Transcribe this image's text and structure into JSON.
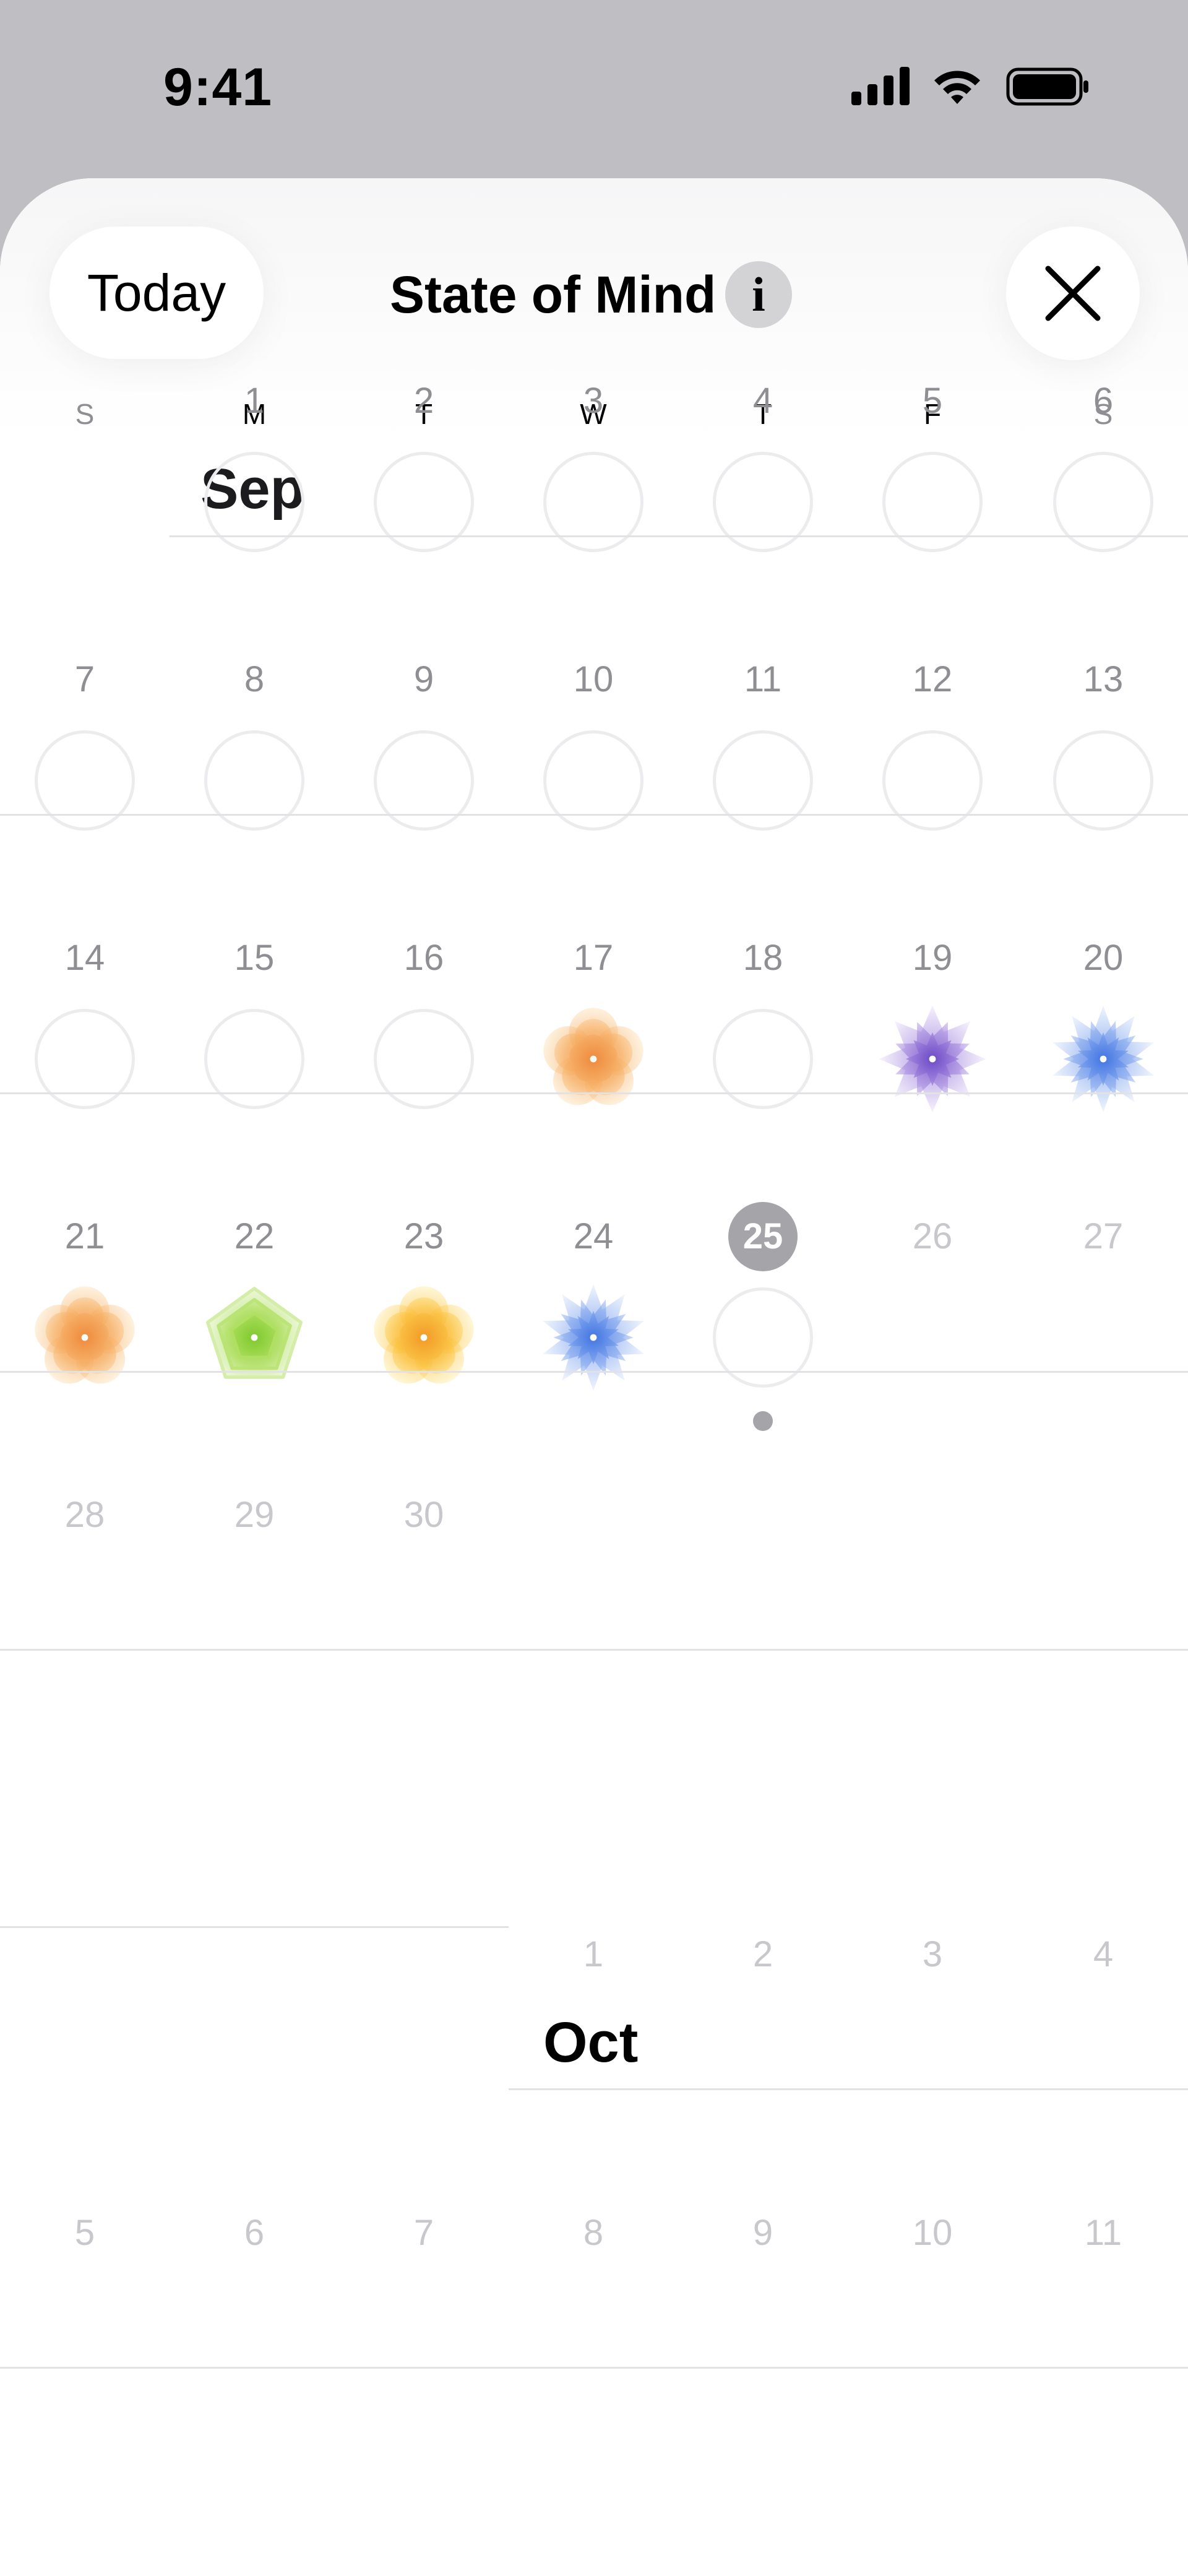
{
  "status_bar": {
    "time": "9:41",
    "icons": [
      "cellular-signal-icon",
      "wifi-icon",
      "battery-icon"
    ]
  },
  "nav": {
    "today_label": "Today",
    "title": "State of Mind",
    "info_icon": "info-icon",
    "close_icon": "close-icon"
  },
  "weekdays": [
    "S",
    "M",
    "T",
    "W",
    "T",
    "F",
    "S"
  ],
  "september": {
    "label": "Sep",
    "weeks": [
      [
        null,
        {
          "day": "1",
          "mark": "empty"
        },
        {
          "day": "2",
          "mark": "empty"
        },
        {
          "day": "3",
          "mark": "empty"
        },
        {
          "day": "4",
          "mark": "empty"
        },
        {
          "day": "5",
          "mark": "empty"
        },
        {
          "day": "6",
          "mark": "empty"
        }
      ],
      [
        {
          "day": "7",
          "mark": "empty"
        },
        {
          "day": "8",
          "mark": "empty"
        },
        {
          "day": "9",
          "mark": "empty"
        },
        {
          "day": "10",
          "mark": "empty"
        },
        {
          "day": "11",
          "mark": "empty"
        },
        {
          "day": "12",
          "mark": "empty"
        },
        {
          "day": "13",
          "mark": "empty"
        }
      ],
      [
        {
          "day": "14",
          "mark": "empty"
        },
        {
          "day": "15",
          "mark": "empty"
        },
        {
          "day": "16",
          "mark": "empty"
        },
        {
          "day": "17",
          "mark": "pleasant-orange"
        },
        {
          "day": "18",
          "mark": "empty"
        },
        {
          "day": "19",
          "mark": "unpleasant-purple"
        },
        {
          "day": "20",
          "mark": "unpleasant-blue"
        }
      ],
      [
        {
          "day": "21",
          "mark": "pleasant-orange"
        },
        {
          "day": "22",
          "mark": "neutral-green"
        },
        {
          "day": "23",
          "mark": "pleasant-yellow"
        },
        {
          "day": "24",
          "mark": "unpleasant-blue"
        },
        {
          "day": "25",
          "mark": "empty",
          "today": true,
          "dot": true
        },
        {
          "day": "26",
          "future": true
        },
        {
          "day": "27",
          "future": true
        }
      ],
      [
        {
          "day": "28",
          "future": true
        },
        {
          "day": "29",
          "future": true
        },
        {
          "day": "30",
          "future": true
        },
        null,
        null,
        null,
        null
      ]
    ]
  },
  "october": {
    "label": "Oct",
    "weeks": [
      [
        null,
        null,
        null,
        {
          "day": "1",
          "future": true
        },
        {
          "day": "2",
          "future": true
        },
        {
          "day": "3",
          "future": true
        },
        {
          "day": "4",
          "future": true
        }
      ],
      [
        {
          "day": "5",
          "future": true
        },
        {
          "day": "6",
          "future": true
        },
        {
          "day": "7",
          "future": true
        },
        {
          "day": "8",
          "future": true
        },
        {
          "day": "9",
          "future": true
        },
        {
          "day": "10",
          "future": true
        },
        {
          "day": "11",
          "future": true
        }
      ]
    ]
  },
  "colors": {
    "pleasant-orange": [
      "#fde7c6",
      "#f7b36b",
      "#ee8a3c"
    ],
    "pleasant-yellow": [
      "#fff1b8",
      "#fbc445",
      "#f19a26"
    ],
    "neutral-green": [
      "#e5f5c7",
      "#b1e062",
      "#7cc92a"
    ],
    "unpleasant-blue": [
      "#dce7fb",
      "#86a9ee",
      "#3f73e3"
    ],
    "unpleasant-purple": [
      "#e8def8",
      "#a98ee0",
      "#6a47c5"
    ],
    "today": "#a4a4a9",
    "ring": "#ececee"
  }
}
